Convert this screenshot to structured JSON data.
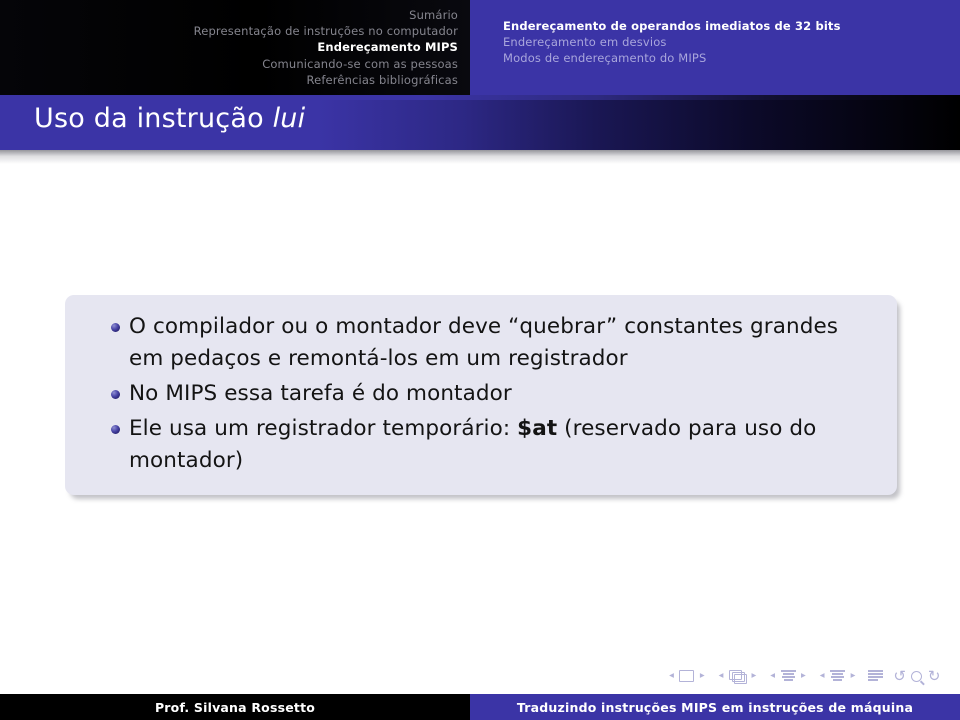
{
  "header": {
    "left_nav": [
      {
        "label": "Sumário",
        "active": false
      },
      {
        "label": "Representação de instruções no computador",
        "active": false
      },
      {
        "label": "Endereçamento MIPS",
        "active": true
      },
      {
        "label": "Comunicando-se com as pessoas",
        "active": false
      },
      {
        "label": "Referências bibliográficas",
        "active": false
      }
    ],
    "right_nav": [
      {
        "label": "Endereçamento de operandos imediatos de 32 bits",
        "active": true
      },
      {
        "label": "Endereçamento em desvios",
        "active": false
      },
      {
        "label": "Modos de endereçamento do MIPS",
        "active": false
      }
    ]
  },
  "title": {
    "prefix": "Uso da instrução ",
    "emphasis": "lui"
  },
  "content": {
    "bullets": [
      {
        "parts": [
          {
            "text": "O compilador ou o montador deve “quebrar” constantes grandes em pedaços e remontá-los em um registrador",
            "bold": false
          }
        ]
      },
      {
        "parts": [
          {
            "text": "No MIPS essa tarefa é do montador",
            "bold": false
          }
        ]
      },
      {
        "parts": [
          {
            "text": "Ele usa um registrador temporário: ",
            "bold": false
          },
          {
            "text": "$at",
            "bold": true
          },
          {
            "text": " (reservado para uso do montador)",
            "bold": false
          }
        ]
      }
    ]
  },
  "navigation_symbols": [
    {
      "icon": "previous-slide-arrow",
      "glyph": "◂"
    },
    {
      "icon": "slide-icon",
      "glyph": ""
    },
    {
      "icon": "next-slide-arrow",
      "glyph": "▸"
    },
    {
      "icon": "previous-frame-arrow",
      "glyph": "◂"
    },
    {
      "icon": "frames-icon",
      "glyph": ""
    },
    {
      "icon": "next-frame-arrow",
      "glyph": "▸"
    },
    {
      "icon": "previous-subsection-arrow",
      "glyph": "◂"
    },
    {
      "icon": "subsection-icon",
      "glyph": ""
    },
    {
      "icon": "next-subsection-arrow",
      "glyph": "▸"
    },
    {
      "icon": "previous-section-arrow",
      "glyph": "◂"
    },
    {
      "icon": "section-icon",
      "glyph": ""
    },
    {
      "icon": "next-section-arrow",
      "glyph": "▸"
    },
    {
      "icon": "all-sections-icon",
      "glyph": ""
    },
    {
      "icon": "back-icon",
      "glyph": "↺"
    },
    {
      "icon": "search-icon",
      "glyph": ""
    },
    {
      "icon": "forward-icon",
      "glyph": "↻"
    }
  ],
  "footer": {
    "author": "Prof. Silvana Rossetto",
    "title": "Traduzindo instruções MIPS em instruções de máquina"
  },
  "colors": {
    "accent_blue": "#3b34a6",
    "block_background": "#e6e6f1",
    "header_black": "#000000",
    "inactive_left_nav": "#85858e",
    "inactive_right_nav": "#a9a6dc",
    "bullet_blue": "#2b2682",
    "nav_symbol": "#b3b3d8"
  }
}
